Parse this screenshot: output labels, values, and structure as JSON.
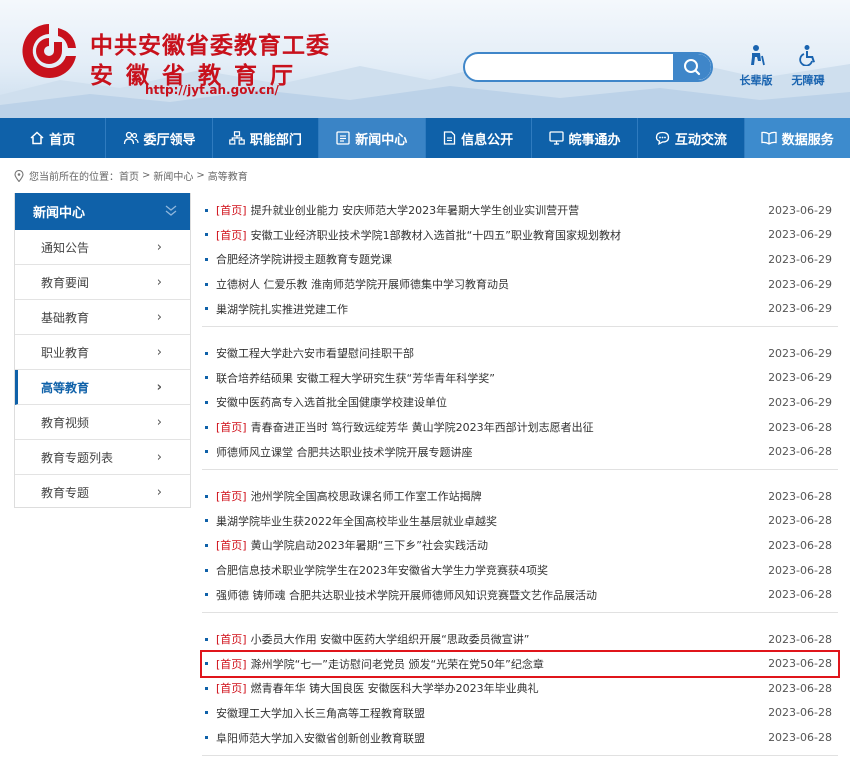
{
  "header": {
    "title_line1": "中共安徽省委教育工委",
    "title_line2": "安徽省教育厅",
    "url": "http://jyt.ah.gov.cn/",
    "search_placeholder": "",
    "access_elder": "长辈版",
    "access_barrier_free": "无障碍"
  },
  "nav": [
    {
      "label": "首页",
      "icon": "home-icon"
    },
    {
      "label": "委厅领导",
      "icon": "people-icon"
    },
    {
      "label": "职能部门",
      "icon": "org-chart-icon"
    },
    {
      "label": "新闻中心",
      "icon": "news-icon"
    },
    {
      "label": "信息公开",
      "icon": "document-icon"
    },
    {
      "label": "皖事通办",
      "icon": "monitor-icon"
    },
    {
      "label": "互动交流",
      "icon": "chat-icon"
    },
    {
      "label": "数据服务",
      "icon": "book-icon"
    }
  ],
  "breadcrumb": {
    "prefix": "您当前所在的位置：",
    "items": [
      "首页",
      "新闻中心",
      "高等教育"
    ],
    "separator": ">"
  },
  "sidebar": {
    "heading": "新闻中心",
    "items": [
      {
        "label": "通知公告",
        "active": false
      },
      {
        "label": "教育要闻",
        "active": false
      },
      {
        "label": "基础教育",
        "active": false
      },
      {
        "label": "职业教育",
        "active": false
      },
      {
        "label": "高等教育",
        "active": true
      },
      {
        "label": "教育视频",
        "active": false
      },
      {
        "label": "教育专题列表",
        "active": false
      },
      {
        "label": "教育专题",
        "active": false
      }
    ]
  },
  "news_groups": [
    [
      {
        "tag": "[首页]",
        "title": "提升就业创业能力 安庆师范大学2023年暑期大学生创业实训营开营",
        "date": "2023-06-29"
      },
      {
        "tag": "[首页]",
        "title": "安徽工业经济职业技术学院1部教材入选首批“十四五”职业教育国家规划教材",
        "date": "2023-06-29"
      },
      {
        "tag": "",
        "title": "合肥经济学院讲授主题教育专题党课",
        "date": "2023-06-29"
      },
      {
        "tag": "",
        "title": "立德树人 仁爱乐教 淮南师范学院开展师德集中学习教育动员",
        "date": "2023-06-29"
      },
      {
        "tag": "",
        "title": "巢湖学院扎实推进党建工作",
        "date": "2023-06-29"
      }
    ],
    [
      {
        "tag": "",
        "title": "安徽工程大学赴六安市看望慰问挂职干部",
        "date": "2023-06-29"
      },
      {
        "tag": "",
        "title": "联合培养结硕果 安徽工程大学研究生获“芳华青年科学奖”",
        "date": "2023-06-29"
      },
      {
        "tag": "",
        "title": "安徽中医药高专入选首批全国健康学校建设单位",
        "date": "2023-06-29"
      },
      {
        "tag": "[首页]",
        "title": "青春奋进正当时 笃行致远绽芳华 黄山学院2023年西部计划志愿者出征",
        "date": "2023-06-28"
      },
      {
        "tag": "",
        "title": "师德师风立课堂 合肥共达职业技术学院开展专题讲座",
        "date": "2023-06-28"
      }
    ],
    [
      {
        "tag": "[首页]",
        "title": "池州学院全国高校思政课名师工作室工作站揭牌",
        "date": "2023-06-28"
      },
      {
        "tag": "",
        "title": "巢湖学院毕业生获2022年全国高校毕业生基层就业卓越奖",
        "date": "2023-06-28"
      },
      {
        "tag": "[首页]",
        "title": "黄山学院启动2023年暑期“三下乡”社会实践活动",
        "date": "2023-06-28"
      },
      {
        "tag": "",
        "title": "合肥信息技术职业学院学生在2023年安徽省大学生力学竞赛获4项奖",
        "date": "2023-06-28"
      },
      {
        "tag": "",
        "title": "强师德 铸师魂 合肥共达职业技术学院开展师德师风知识竞赛暨文艺作品展活动",
        "date": "2023-06-28"
      }
    ],
    [
      {
        "tag": "[首页]",
        "title": "小委员大作用 安徽中医药大学组织开展“思政委员微宣讲”",
        "date": "2023-06-28"
      },
      {
        "tag": "[首页]",
        "title": "滁州学院“七一”走访慰问老党员 颁发“光荣在党50年”纪念章",
        "date": "2023-06-28",
        "highlight": true
      },
      {
        "tag": "[首页]",
        "title": "燃青春年华 铸大国良医 安徽医科大学举办2023年毕业典礼",
        "date": "2023-06-28"
      },
      {
        "tag": "",
        "title": "安徽理工大学加入长三角高等工程教育联盟",
        "date": "2023-06-28"
      },
      {
        "tag": "",
        "title": "阜阳师范大学加入安徽省创新创业教育联盟",
        "date": "2023-06-28"
      }
    ]
  ],
  "colors": {
    "primary": "#0f61a9",
    "brand_red": "#c8111c",
    "highlight": "#e0151b"
  }
}
